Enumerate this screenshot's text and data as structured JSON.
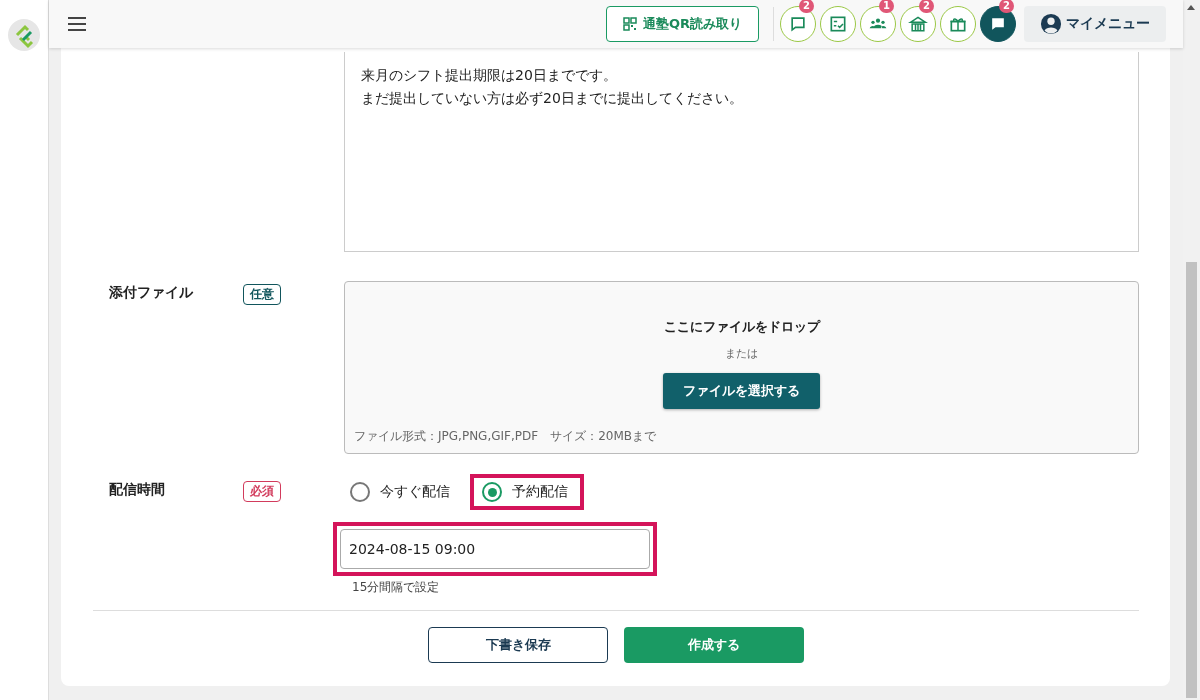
{
  "header": {
    "qr_button": "通塾QR読み取り",
    "icons": [
      {
        "kind": "comment",
        "badge": "2",
        "selected": false
      },
      {
        "kind": "checklist",
        "selected": false
      },
      {
        "kind": "group",
        "badge": "1",
        "selected": false
      },
      {
        "kind": "school",
        "badge": "2",
        "selected": false
      },
      {
        "kind": "gift",
        "selected": false
      },
      {
        "kind": "chat",
        "badge": "2",
        "selected": true
      }
    ],
    "menu_button": "マイメニュー"
  },
  "form": {
    "message": {
      "lines": [
        "来月のシフト提出期限は20日までです。",
        "まだ提出していない方は必ず20日までに提出してください。"
      ]
    },
    "attachment": {
      "label": "添付ファイル",
      "tag": {
        "text": "任意",
        "color": "#11555c"
      },
      "drop_text": "ここにファイルをドロップ",
      "or_text": "または",
      "select_button": "ファイルを選択する",
      "note": "ファイル形式：JPG,PNG,GIF,PDF　サイズ：20MBまで"
    },
    "delivery": {
      "label": "配信時間",
      "tag": {
        "text": "必須",
        "color": "#d23b5c"
      },
      "options": [
        {
          "label": "今すぐ配信",
          "selected": false,
          "highlighted": false
        },
        {
          "label": "予約配信",
          "selected": true,
          "highlighted": true
        }
      ],
      "datetime": {
        "value": "2024-08-15 09:00",
        "highlighted": true
      },
      "hint": "15分間隔で設定"
    }
  },
  "actions": {
    "draft_button": "下書き保存",
    "create_button": "作成する"
  }
}
